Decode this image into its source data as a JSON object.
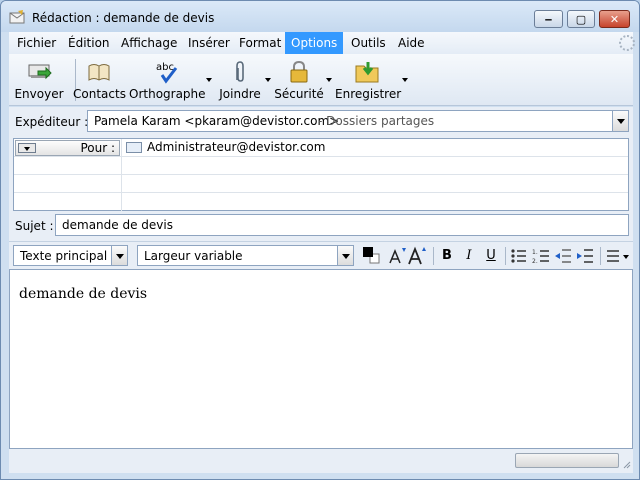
{
  "window": {
    "title": "Rédaction : demande de devis",
    "buttons": {
      "minimize": "‒",
      "maximize": "▢",
      "close": "✕"
    }
  },
  "menu": [
    {
      "label": "Fichier",
      "active": false
    },
    {
      "label": "Édition",
      "active": false
    },
    {
      "label": "Affichage",
      "active": false
    },
    {
      "label": "Insérer",
      "active": false
    },
    {
      "label": "Format",
      "active": false
    },
    {
      "label": "Options",
      "active": true
    },
    {
      "label": "Outils",
      "active": false
    },
    {
      "label": "Aide",
      "active": false
    }
  ],
  "toolbar": {
    "send": "Envoyer",
    "contacts": "Contacts",
    "spelling": "Orthographe",
    "spelling_icon_text": "abc",
    "attach": "Joindre",
    "security": "Sécurité",
    "save": "Enregistrer"
  },
  "header": {
    "sender_label": "Expéditeur :",
    "sender_value": "Pamela Karam <pkaram@devistor.com>",
    "sender_folder": "- Dossiers partages",
    "recipient_type": "Pour :",
    "recipient_value": "Administrateur@devistor.com",
    "subject_label": "Sujet :",
    "subject_value": "demande de devis"
  },
  "format_toolbar": {
    "paragraph_style": "Texte principal",
    "font": "Largeur variable",
    "bold": "B",
    "italic": "I",
    "underline": "U"
  },
  "body": {
    "text": "demande de devis"
  },
  "colors": {
    "menu_active": "#3399ff",
    "window_bg": "#cfdff0",
    "close_button": "#c7432c"
  }
}
